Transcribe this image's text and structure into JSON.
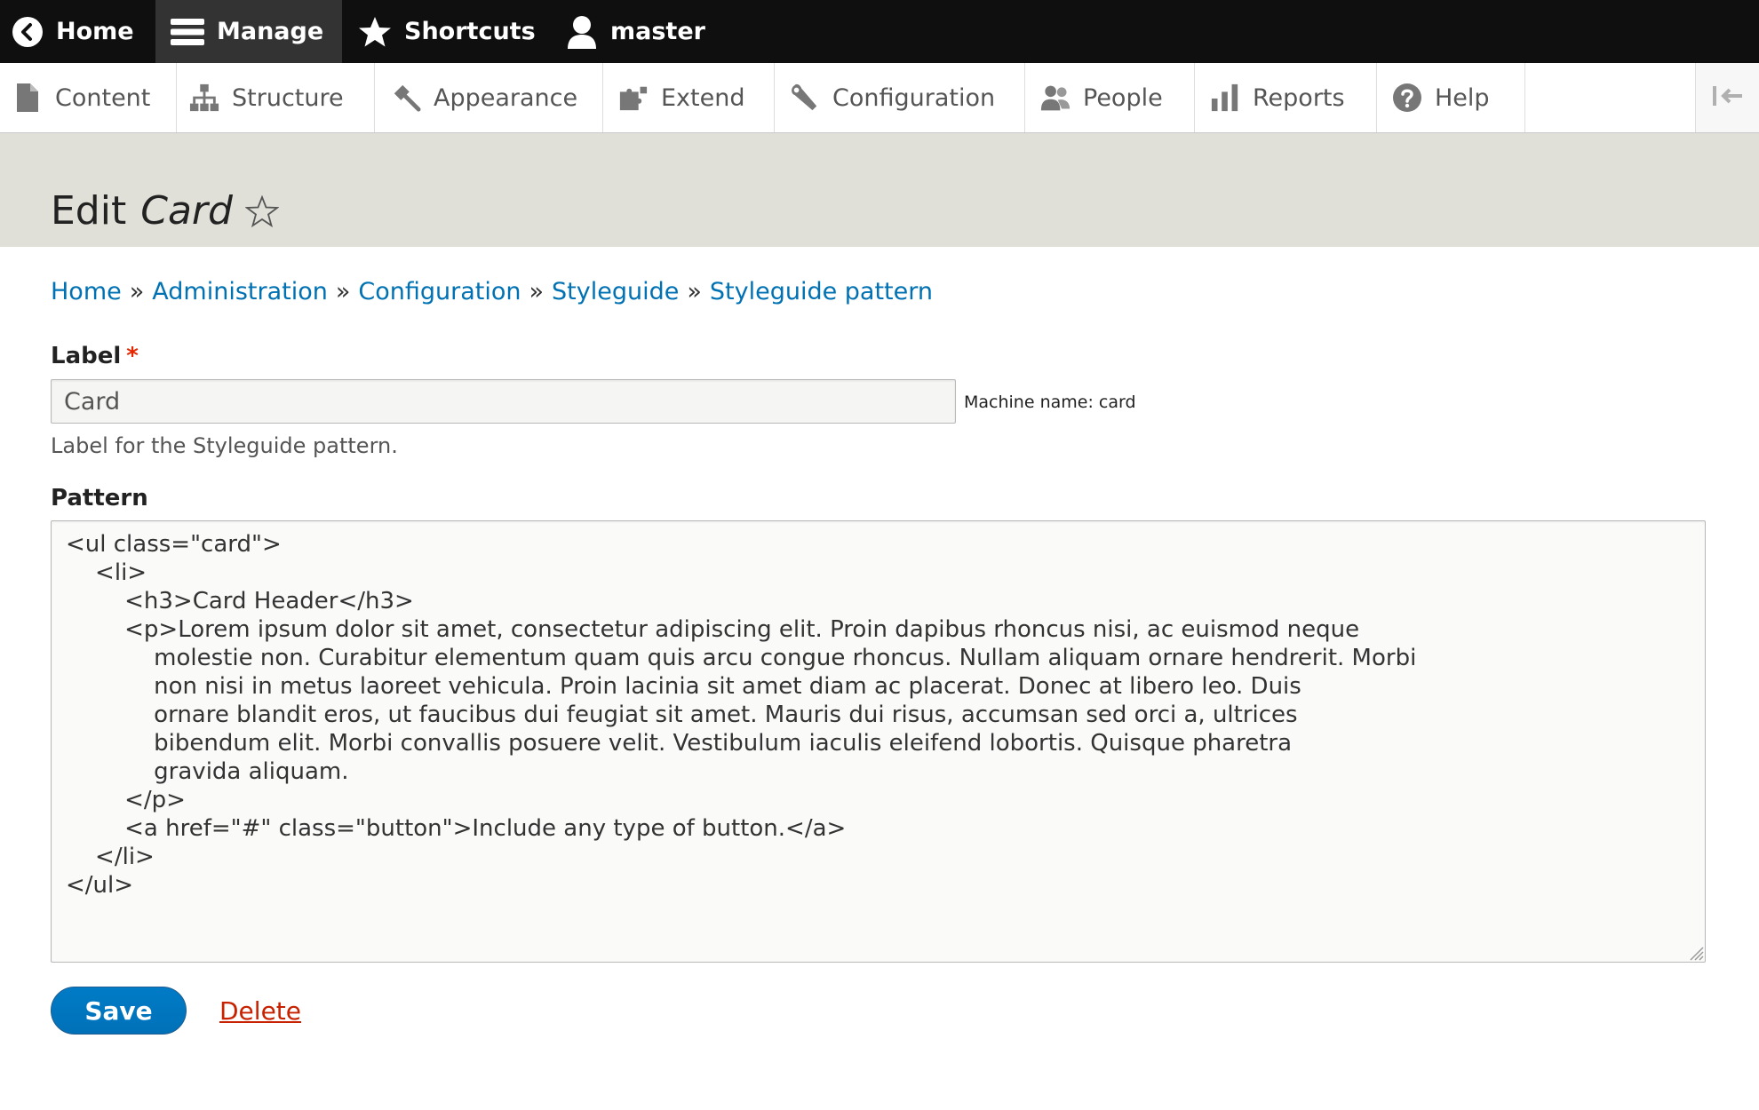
{
  "toolbar": {
    "home_label": "Home",
    "manage_label": "Manage",
    "shortcuts_label": "Shortcuts",
    "user_label": "master"
  },
  "tray": {
    "items": [
      {
        "label": "Content",
        "icon": "file-icon"
      },
      {
        "label": "Structure",
        "icon": "sitemap-icon"
      },
      {
        "label": "Appearance",
        "icon": "paintbrush-icon"
      },
      {
        "label": "Extend",
        "icon": "puzzle-icon"
      },
      {
        "label": "Configuration",
        "icon": "wrench-icon"
      },
      {
        "label": "People",
        "icon": "people-icon"
      },
      {
        "label": "Reports",
        "icon": "bar-chart-icon"
      },
      {
        "label": "Help",
        "icon": "help-icon"
      }
    ]
  },
  "header": {
    "title_prefix": "Edit",
    "title_italic": "Card"
  },
  "breadcrumb": {
    "items": [
      "Home",
      "Administration",
      "Configuration",
      "Styleguide",
      "Styleguide pattern"
    ],
    "separator": "»"
  },
  "form": {
    "label_title": "Label",
    "required_mark": "*",
    "label_value": "Card",
    "machine_name": "Machine name: card",
    "label_description": "Label for the Styleguide pattern.",
    "pattern_title": "Pattern",
    "pattern_value": "<ul class=\"card\">\n    <li>\n        <h3>Card Header</h3>\n        <p>Lorem ipsum dolor sit amet, consectetur adipiscing elit. Proin dapibus rhoncus nisi, ac euismod neque\n            molestie non. Curabitur elementum quam quis arcu congue rhoncus. Nullam aliquam ornare hendrerit. Morbi\n            non nisi in metus laoreet vehicula. Proin lacinia sit amet diam ac placerat. Donec at libero leo. Duis\n            ornare blandit eros, ut faucibus dui feugiat sit amet. Mauris dui risus, accumsan sed orci a, ultrices\n            bibendum elit. Morbi convallis posuere velit. Vestibulum iaculis eleifend lobortis. Quisque pharetra\n            gravida aliquam.\n        </p>\n        <a href=\"#\" class=\"button\">Include any type of button.</a>\n    </li>\n</ul>",
    "save_label": "Save",
    "delete_label": "Delete"
  },
  "colors": {
    "toolbar_bg": "#0f0f0f",
    "manage_active_bg": "#333333",
    "header_bg": "#e0e0d8",
    "link": "#0071b3",
    "primary_button": "#0071b8",
    "danger_link": "#c72100",
    "required": "#e62600"
  }
}
